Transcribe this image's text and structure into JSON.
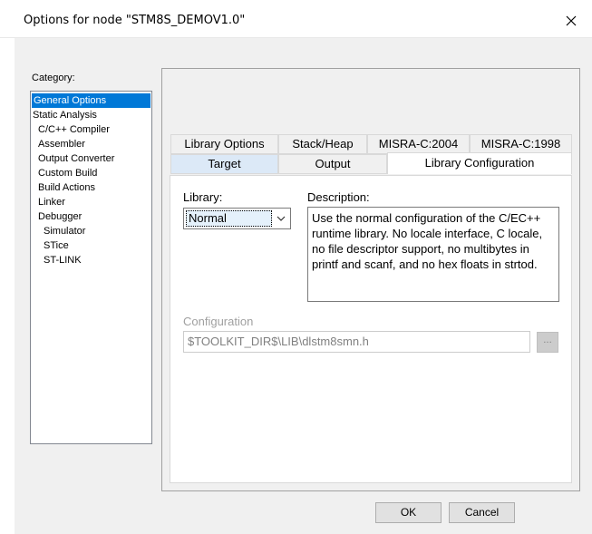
{
  "window": {
    "title": "Options for node \"STM8S_DEMOV1.0\"",
    "close_icon": "close-icon"
  },
  "category": {
    "label": "Category:",
    "items": [
      {
        "label": "General Options",
        "level": 0,
        "selected": true
      },
      {
        "label": "Static Analysis",
        "level": 0
      },
      {
        "label": "C/C++ Compiler",
        "level": 1
      },
      {
        "label": "Assembler",
        "level": 1
      },
      {
        "label": "Output Converter",
        "level": 1
      },
      {
        "label": "Custom Build",
        "level": 1
      },
      {
        "label": "Build Actions",
        "level": 1
      },
      {
        "label": "Linker",
        "level": 1
      },
      {
        "label": "Debugger",
        "level": 1
      },
      {
        "label": "Simulator",
        "level": 2
      },
      {
        "label": "STice",
        "level": 2
      },
      {
        "label": "ST-LINK",
        "level": 2
      }
    ]
  },
  "tabs": {
    "row1": [
      "Library Options",
      "Stack/Heap",
      "MISRA-C:2004",
      "MISRA-C:1998"
    ],
    "row2": [
      "Target",
      "Output",
      "Library Configuration"
    ],
    "active": "Library Configuration"
  },
  "library": {
    "label": "Library:",
    "value": "Normal",
    "description_label": "Description:",
    "description": "Use the normal configuration of the C/EC++ runtime library. No locale interface, C locale, no file descriptor support, no multibytes in printf and scanf, and no hex floats in strtod."
  },
  "configuration": {
    "label": "Configuration",
    "value": "$TOOLKIT_DIR$\\LIB\\dlstm8smn.h",
    "browse_label": "..."
  },
  "buttons": {
    "ok": "OK",
    "cancel": "Cancel"
  },
  "colors": {
    "selection": "#0078d7",
    "tab_highlight": "#dce9f7",
    "dialog_bg": "#f0f0f0"
  }
}
